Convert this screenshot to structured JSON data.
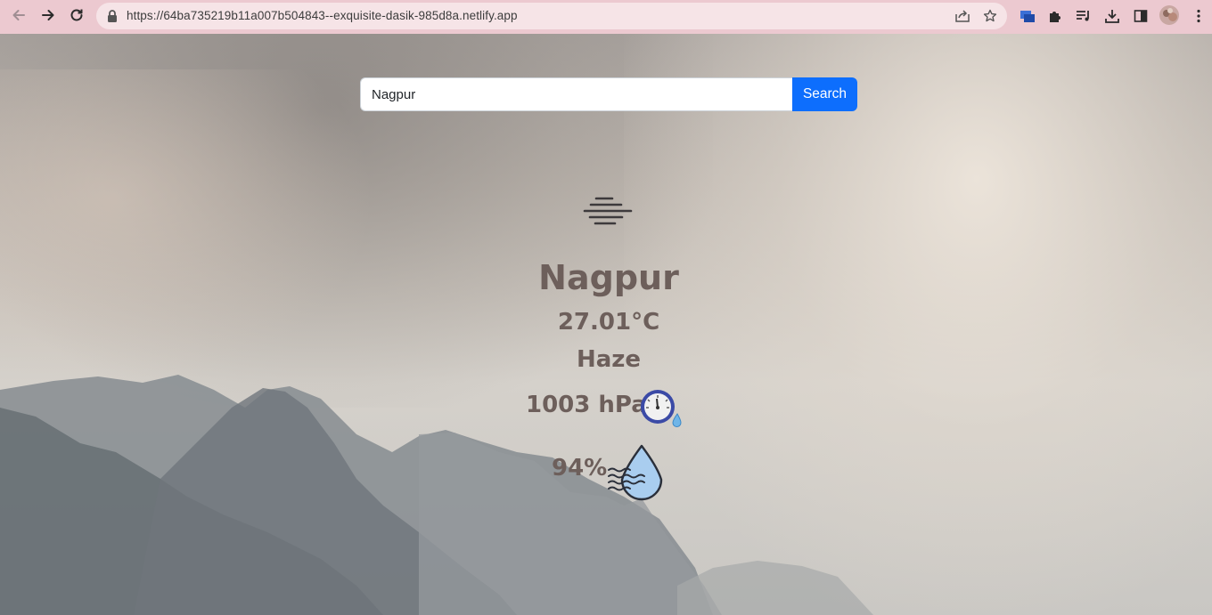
{
  "browser": {
    "url": "https://64ba735219b11a007b504843--exquisite-dasik-985d8a.netlify.app",
    "icons": [
      "back-icon",
      "forward-icon",
      "reload-icon",
      "lock-icon",
      "share-icon",
      "bookmark-star-icon",
      "extension-app-icon",
      "puzzle-extensions-icon",
      "media-queue-icon",
      "download-icon",
      "side-panel-icon",
      "profile-avatar",
      "more-menu-icon"
    ]
  },
  "search": {
    "value": "Nagpur",
    "button_label": "Search"
  },
  "weather": {
    "condition_icon": "haze-icon",
    "city": "Nagpur",
    "temperature": "27.01°C",
    "condition": "Haze",
    "pressure": "1003 hPa",
    "pressure_icon": "barometer-icon",
    "humidity": "94%",
    "humidity_icon": "humidity-drop-icon"
  },
  "colors": {
    "chrome_bg": "#ecc9d0",
    "text": "#6d5f5b",
    "search_button": "#0d6efd"
  }
}
